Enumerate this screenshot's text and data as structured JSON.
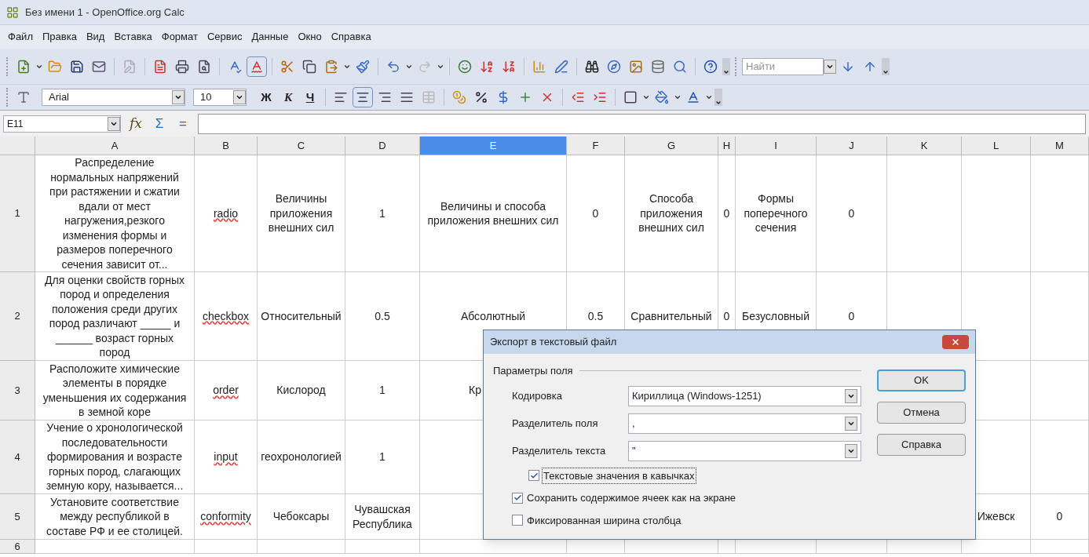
{
  "window": {
    "title": "Без имени 1 - OpenOffice.org Calc"
  },
  "menu": [
    "Файл",
    "Правка",
    "Вид",
    "Вставка",
    "Формат",
    "Сервис",
    "Данные",
    "Окно",
    "Справка"
  ],
  "toolbar": {
    "auto_spellcheck_on": true,
    "find_placeholder": "Найти"
  },
  "format_toolbar": {
    "font": "Arial",
    "size": "10",
    "style_buttons": [
      "Ж",
      "К",
      "Ч"
    ],
    "align_center_on": true
  },
  "formula_bar": {
    "cell_ref": "E11",
    "buttons": [
      "fx",
      "Σ",
      "="
    ]
  },
  "columns": [
    {
      "label": "A",
      "selected": false
    },
    {
      "label": "B",
      "selected": false
    },
    {
      "label": "C",
      "selected": false
    },
    {
      "label": "D",
      "selected": false
    },
    {
      "label": "E",
      "selected": true
    },
    {
      "label": "F",
      "selected": false
    },
    {
      "label": "G",
      "selected": false
    },
    {
      "label": "H",
      "selected": false
    },
    {
      "label": "I",
      "selected": false
    },
    {
      "label": "J",
      "selected": false
    },
    {
      "label": "K",
      "selected": false
    },
    {
      "label": "L",
      "selected": false
    },
    {
      "label": "M",
      "selected": false
    }
  ],
  "rows": [
    {
      "header": "1",
      "cells": {
        "A": "Распределение нормальных напряжений при растяжении и сжатии вдали от мест нагружения,резкого изменения формы и размеров поперечного сечения зависит от...",
        "B": {
          "text": "radio",
          "misspelled": true
        },
        "C": "Величины приложения внешних сил",
        "D": "1",
        "E": "Величины и способа приложения внешних сил",
        "F": "0",
        "G": "Способа приложения внешних сил",
        "H": "0",
        "I": "Формы поперечного сечения",
        "J": "0"
      }
    },
    {
      "header": "2",
      "cells": {
        "A": "Для оценки свойств горных пород и определения положения среди других пород различают _____ и ______ возраст горных пород",
        "B": {
          "text": "checkbox",
          "misspelled": true
        },
        "C": "Относительный",
        "D": "0.5",
        "E": "Абсолютный",
        "F": "0.5",
        "G": "Сравнительный",
        "H": "0",
        "I": "Безусловный",
        "J": "0"
      }
    },
    {
      "header": "3",
      "cells": {
        "A": "Расположите химические элементы в порядке уменьшения их содержания в земной коре",
        "B": {
          "text": "order",
          "misspelled": true
        },
        "C": "Кислород",
        "D": "1",
        "E": {
          "text": "Кр",
          "clipped": true
        }
      }
    },
    {
      "header": "4",
      "cells": {
        "A": "Учение о хронологической последовательности формирования и возрасте горных пород, слагающих земную кору, называется...",
        "B": {
          "text": "input",
          "misspelled": true
        },
        "C": "геохронологией",
        "D": "1"
      }
    },
    {
      "header": "5",
      "cells": {
        "A": "Установите соответствие между республикой в составе РФ и ее столицей.",
        "B": {
          "text": "conformity",
          "misspelled": true
        },
        "C": "Чебоксары",
        "D": "Чувашская Республика",
        "L": "Ижевск",
        "M": "0"
      }
    },
    {
      "header": "6",
      "cells": {}
    }
  ],
  "dialog": {
    "title": "Экспорт в текстовый файл",
    "group": "Параметры поля",
    "fields": [
      {
        "label": "Кодировка",
        "value": "Кириллица (Windows-1251)"
      },
      {
        "label": "Разделитель поля",
        "value": ","
      },
      {
        "label": "Разделитель текста",
        "value": "\""
      }
    ],
    "checkboxes": [
      {
        "label": "Текстовые значения в кавычках",
        "checked": true,
        "focused": true,
        "indented": true
      },
      {
        "label": "Сохранить содержимое ячеек как на экране",
        "checked": true,
        "focused": false,
        "indented": false
      },
      {
        "label": "Фиксированная ширина столбца",
        "checked": false,
        "focused": false,
        "indented": false
      }
    ],
    "buttons": [
      {
        "label": "OK",
        "default": true
      },
      {
        "label": "Отмена",
        "default": false
      },
      {
        "label": "Справка",
        "default": false
      }
    ]
  }
}
